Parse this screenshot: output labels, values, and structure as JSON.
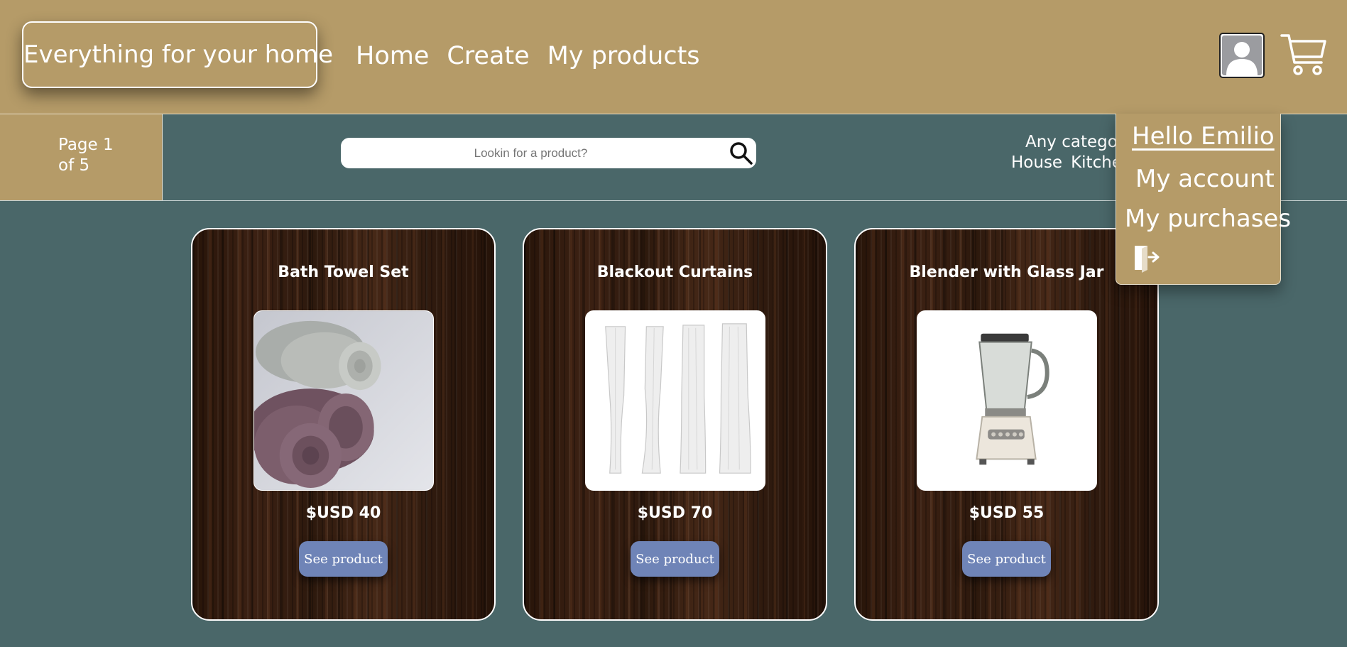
{
  "header": {
    "brand": "Everything for your home",
    "nav": [
      "Home",
      "Create",
      "My products"
    ],
    "icons": {
      "avatar": "user-avatar-icon",
      "cart": "shopping-cart-icon"
    }
  },
  "subbar": {
    "page_line1": "Page 1",
    "page_line2": "of 5",
    "search_placeholder": "Lookin for a product?",
    "categories_title": "Any category",
    "categories": [
      "House",
      "Kitchen"
    ]
  },
  "products": [
    {
      "name": "Bath Towel Set",
      "price": "$USD 40",
      "button": "See product",
      "image": "rolled-towels"
    },
    {
      "name": "Blackout Curtains",
      "price": "$USD 70",
      "button": "See product",
      "image": "white-curtains"
    },
    {
      "name": "Blender with Glass Jar",
      "price": "$USD 55",
      "button": "See product",
      "image": "blender"
    }
  ],
  "user_menu": {
    "greeting": "Hello Emilio",
    "items": [
      "My account",
      "My purchases"
    ],
    "logout_icon": "logout-door-icon"
  },
  "colors": {
    "header": "#b59b68",
    "background": "#4a6769",
    "button": "#6f84b7",
    "card_wood": "#3c2113"
  }
}
